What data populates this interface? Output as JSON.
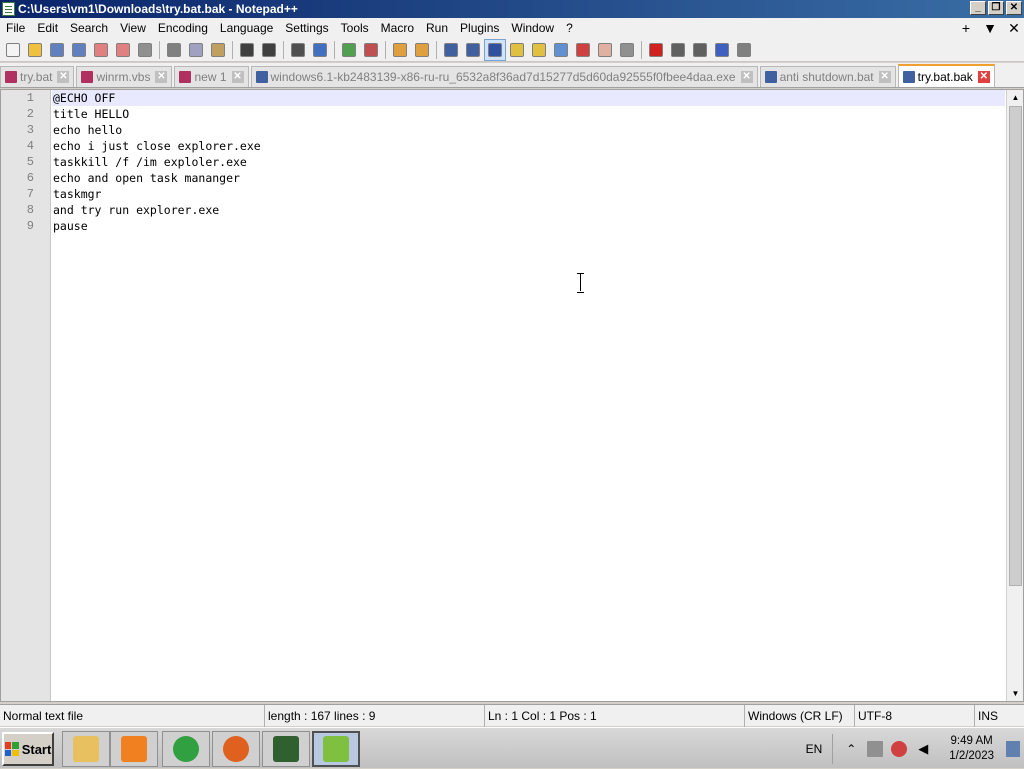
{
  "window": {
    "title": "C:\\Users\\vm1\\Downloads\\try.bat.bak - Notepad++",
    "controls": [
      "_",
      "❐",
      "✕"
    ]
  },
  "menu": {
    "items": [
      "File",
      "Edit",
      "Search",
      "View",
      "Encoding",
      "Language",
      "Settings",
      "Tools",
      "Macro",
      "Run",
      "Plugins",
      "Window",
      "?"
    ],
    "right": [
      "+",
      "▼",
      "✕"
    ]
  },
  "toolbar": {
    "buttons": [
      {
        "icon": "new-file-icon",
        "color": "#f4f4f4"
      },
      {
        "icon": "open-file-icon",
        "color": "#f0c040"
      },
      {
        "icon": "save-icon",
        "color": "#6080c0"
      },
      {
        "icon": "save-all-icon",
        "color": "#6080c0"
      },
      {
        "icon": "close-icon",
        "color": "#e08080"
      },
      {
        "icon": "close-all-icon",
        "color": "#e08080"
      },
      {
        "icon": "print-icon",
        "color": "#909090"
      },
      {
        "sep": true
      },
      {
        "icon": "cut-icon",
        "color": "#808080"
      },
      {
        "icon": "copy-icon",
        "color": "#a0a0c0"
      },
      {
        "icon": "paste-icon",
        "color": "#c0a060"
      },
      {
        "sep": true
      },
      {
        "icon": "undo-icon",
        "color": "#404040"
      },
      {
        "icon": "redo-icon",
        "color": "#404040"
      },
      {
        "sep": true
      },
      {
        "icon": "find-icon",
        "color": "#505050"
      },
      {
        "icon": "replace-icon",
        "color": "#4070c0"
      },
      {
        "sep": true
      },
      {
        "icon": "zoom-in-icon",
        "color": "#50a050"
      },
      {
        "icon": "zoom-out-icon",
        "color": "#c05050"
      },
      {
        "sep": true
      },
      {
        "icon": "sync-vertical-icon",
        "color": "#e0a040"
      },
      {
        "icon": "sync-horizontal-icon",
        "color": "#e0a040"
      },
      {
        "sep": true
      },
      {
        "icon": "word-wrap-icon",
        "color": "#4060a0"
      },
      {
        "icon": "show-all-chars-icon",
        "color": "#4060a0"
      },
      {
        "icon": "indent-guide-icon",
        "color": "#3050a0",
        "active": true
      },
      {
        "icon": "user-language-icon",
        "color": "#e0c040"
      },
      {
        "icon": "document-map-icon",
        "color": "#e0c040"
      },
      {
        "icon": "function-list-icon",
        "color": "#6090d0"
      },
      {
        "icon": "folder-workspace-icon",
        "color": "#d04040"
      },
      {
        "icon": "folder-icon",
        "color": "#e0b0a0"
      },
      {
        "icon": "monitoring-icon",
        "color": "#909090"
      },
      {
        "sep": true
      },
      {
        "icon": "macro-record-icon",
        "color": "#d02020"
      },
      {
        "icon": "macro-stop-icon",
        "color": "#606060"
      },
      {
        "icon": "macro-play-icon",
        "color": "#606060"
      },
      {
        "icon": "macro-run-multiple-icon",
        "color": "#4060c0"
      },
      {
        "icon": "macro-save-icon",
        "color": "#808080"
      }
    ]
  },
  "tabs": [
    {
      "label": "try.bat",
      "icon_color": "#b03060",
      "active": false
    },
    {
      "label": "winrm.vbs",
      "icon_color": "#b03060",
      "active": false
    },
    {
      "label": "new 1",
      "icon_color": "#b03060",
      "active": false
    },
    {
      "label": "windows6.1-kb2483139-x86-ru-ru_6532a8f36ad7d15277d5d60da92555f0fbee4daa.exe",
      "icon_color": "#4060a0",
      "active": false
    },
    {
      "label": "anti shutdown.bat",
      "icon_color": "#4060a0",
      "active": false
    },
    {
      "label": "try.bat.bak",
      "icon_color": "#4060a0",
      "active": true
    }
  ],
  "editor": {
    "lines": [
      "@ECHO OFF",
      "title HELLO",
      "echo hello",
      "echo i just close explorer.exe",
      "taskkill /f /im exploler.exe",
      "echo and open task mananger",
      "taskmgr",
      "and try run explorer.exe",
      "pause"
    ],
    "current_line": 1
  },
  "status": {
    "file_type": "Normal text file",
    "length": "length : 167    lines : 9",
    "position": "Ln : 1    Col : 1    Pos : 1",
    "eol": "Windows (CR LF)",
    "encoding": "UTF-8",
    "mode": "INS"
  },
  "taskbar": {
    "start_label": "Start",
    "apps": [
      {
        "name": "explorer-app",
        "color": "#e8c060",
        "active": false
      },
      {
        "name": "media-player-app",
        "color": "#f08020",
        "active": false
      },
      {
        "name": "chrome-app",
        "color": "#30a040",
        "active": false
      },
      {
        "name": "firefox-app",
        "color": "#e06020",
        "active": false
      },
      {
        "name": "task-manager-app",
        "color": "#306030",
        "active": false
      },
      {
        "name": "notepadpp-app",
        "color": "#80c040",
        "active": true
      }
    ],
    "language": "EN",
    "time": "9:49 AM",
    "date": "1/2/2023"
  }
}
